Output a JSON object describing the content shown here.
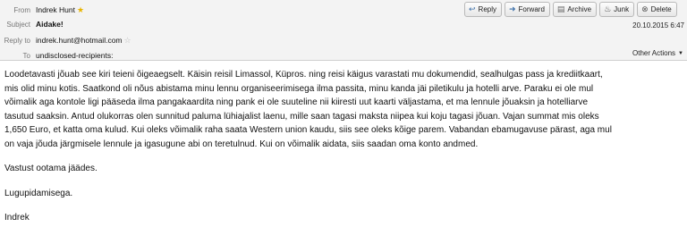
{
  "header": {
    "from_label": "From",
    "from_value": "Indrek Hunt",
    "subject_label": "Subject",
    "subject_value": "Aidake!",
    "replyto_label": "Reply to",
    "replyto_value": "indrek.hunt@hotmail.com",
    "to_label": "To",
    "to_value": "undisclosed-recipients:",
    "date": "20.10.2015 6:47",
    "other_actions": "Other Actions"
  },
  "toolbar": {
    "reply": "Reply",
    "forward": "Forward",
    "archive": "Archive",
    "junk": "Junk",
    "delete": "Delete"
  },
  "icons": {
    "reply": "reply-arrow-icon",
    "forward": "forward-arrow-icon",
    "archive": "archive-box-icon",
    "junk": "junk-flame-icon",
    "delete": "trash-icon",
    "star_from": "star-icon",
    "star_replyto": "star-outline-icon"
  },
  "colors": {
    "accent": "#3a6ea8",
    "star_gold": "#e8b400",
    "header_bg": "#f3f3f3"
  },
  "message": {
    "lines": [
      "Loodetavasti jõuab see kiri teieni õigeaegselt. Käisin reisil Limassol, Küpros. ning reisi käigus varastati mu dokumendid, sealhulgas pass ja krediitkaart,",
      "mis olid minu kotis. Saatkond oli nõus abistama minu lennu organiseerimisega ilma passita, minu kanda jäi piletikulu ja hotelli arve. Paraku ei ole mul",
      "võimalik aga kontole ligi pääseda ilma pangakaardita ning pank ei ole suuteline nii kiiresti uut kaarti väljastama, et ma lennule jõuaksin ja hotelliarve",
      "tasutud saaksin. Antud olukorras olen sunnitud paluma lühiajalist laenu, mille saan tagasi maksta niipea kui koju tagasi jõuan. Vajan summat mis oleks",
      "1,650 Euro, et katta oma kulud. Kui oleks võimalik raha saata Western union kaudu, siis see oleks kõige parem. Vabandan ebamugavuse pärast, aga mul",
      "on vaja jõuda järgmisele lennule ja igasugune abi on teretulnud. Kui on võimalik aidata, siis saadan oma konto andmed."
    ],
    "closing1": "Vastust ootama jäädes.",
    "closing2": "Lugupidamisega.",
    "signature": "Indrek"
  }
}
